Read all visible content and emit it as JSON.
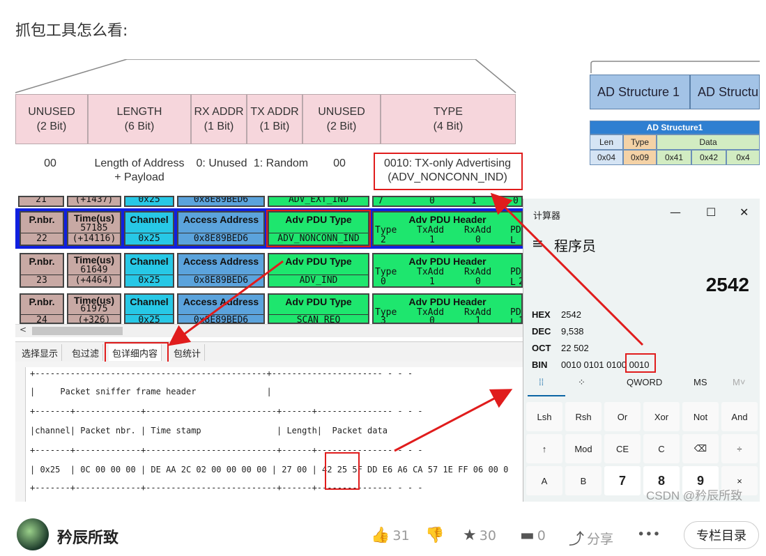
{
  "heading": "抓包工具怎么看:",
  "pdu_header": {
    "fields": [
      {
        "name": "UNUSED",
        "bits": "(2 Bit)",
        "value": "00"
      },
      {
        "name": "LENGTH",
        "bits": "(6 Bit)",
        "value": "Length of Address + Payload"
      },
      {
        "name": "RX ADDR",
        "bits": "(1 Bit)",
        "value": "0: Unused"
      },
      {
        "name": "TX ADDR",
        "bits": "(1 Bit)",
        "value": "1: Random"
      },
      {
        "name": "UNUSED",
        "bits": "(2 Bit)",
        "value": "00"
      },
      {
        "name": "TYPE",
        "bits": "(4 Bit)",
        "value": "0010: TX-only Advertising (ADV_NONCONN_IND)"
      }
    ]
  },
  "ad_structure": {
    "boxes": [
      "AD Structure 1",
      "AD Structu"
    ],
    "table_title": "AD Structure1",
    "cols": [
      "Len",
      "Type",
      "Data"
    ],
    "row": [
      "0x04",
      "0x09",
      "0x41",
      "0x42",
      "0x4"
    ]
  },
  "packets": {
    "partial_top": [
      "21",
      "(+1437)",
      "0x25",
      "0x8E89BED6",
      "ADV_EXT_IND",
      "7",
      "0",
      "1",
      "0"
    ],
    "labels": {
      "nbr": "P.nbr.",
      "time": "Time(us)",
      "channel": "Channel",
      "access": "Access Address",
      "type": "Adv PDU Type",
      "hdr": "Adv PDU Header"
    },
    "hdr_cols": [
      "Type",
      "TxAdd",
      "RxAdd",
      "PDU-L"
    ],
    "rows": [
      {
        "nbr": "22",
        "time": "57185",
        "delta": "(+14116)",
        "channel": "0x25",
        "access": "0x8E89BED6",
        "type": "ADV_NONCONN_IND",
        "h": [
          "2",
          "1",
          "0",
          ""
        ]
      },
      {
        "nbr": "23",
        "time": "61649",
        "delta": "(+4464)",
        "channel": "0x25",
        "access": "0x8E89BED6",
        "type": "ADV_IND",
        "h": [
          "0",
          "1",
          "0",
          "2"
        ]
      },
      {
        "nbr": "24",
        "time": "61975",
        "delta": "(+326)",
        "channel": "0x25",
        "access": "0x8E89BED6",
        "type": "SCAN_REQ",
        "h": [
          "3",
          "0",
          "1",
          "1"
        ]
      }
    ]
  },
  "tabs": [
    "选择显示",
    "包过滤",
    "包详细内容",
    "包统计"
  ],
  "console": {
    "lines": [
      "+----------------------------------------------+---------------------- - - -",
      "|     Packet sniffer frame header              |",
      "+-------+-------------+--------------------------+------+--------------- - - -",
      "|channel| Packet nbr. | Time stamp               | Length|  Packet data",
      "+-------+-------------+--------------------------+------+--------------- - - -",
      "| 0x25  | 0C 00 00 00 | DE AA 2C 02 00 00 00 00 | 27 00 | 42 25 5F DD E6 A6 CA 57 1E FF 06 00 0",
      "+-------+-------------+--------------------------+------+--------------- - - -"
    ]
  },
  "calculator": {
    "title": "计算器",
    "mode": "程序员",
    "display": "2542",
    "radix": [
      {
        "label": "HEX",
        "value": "2542"
      },
      {
        "label": "DEC",
        "value": "9,538"
      },
      {
        "label": "OCT",
        "value": "22 502"
      },
      {
        "label": "BIN",
        "value": "0010 0101 0100 0010"
      }
    ],
    "controls": [
      "QWORD",
      "MS",
      "M˅"
    ],
    "keys": [
      [
        "Lsh",
        "Rsh",
        "Or",
        "Xor",
        "Not",
        "And"
      ],
      [
        "↑",
        "Mod",
        "CE",
        "C",
        "⌫",
        "÷"
      ],
      [
        "A",
        "B",
        "7",
        "8",
        "9",
        "×"
      ]
    ]
  },
  "watermark": "CSDN @矜辰所致",
  "footer": {
    "author": "矜辰所致",
    "likes": "31",
    "favorites": "30",
    "comments": "0",
    "share": "分享",
    "more": "•••",
    "toc": "专栏目录"
  },
  "colors": {
    "red_highlight": "#e01c1c",
    "green_pdu": "#1ee66e",
    "blue_selected": "#1020e0"
  }
}
